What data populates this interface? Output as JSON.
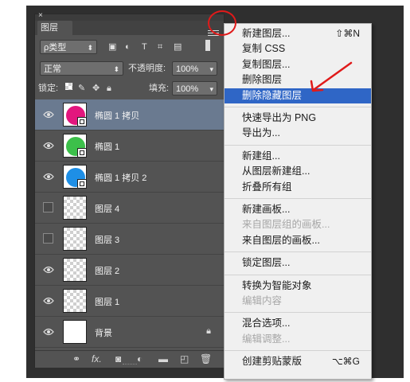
{
  "panel": {
    "tab": "图层",
    "filter_kind": "ρ类型",
    "blend_mode": "正常",
    "opacity_label": "不透明度:",
    "opacity_value": "100%",
    "lock_label": "锁定:",
    "fill_label": "填充:",
    "fill_value": "100%",
    "layers": [
      {
        "name": "椭圆 1 拷贝",
        "visible": true,
        "selected": true,
        "thumb": "circle",
        "color": "#e3167e"
      },
      {
        "name": "椭圆 1",
        "visible": true,
        "selected": false,
        "thumb": "circle",
        "color": "#3cc04a"
      },
      {
        "name": "椭圆 1 拷贝 2",
        "visible": true,
        "selected": false,
        "thumb": "circle",
        "color": "#1e8fe6"
      },
      {
        "name": "图层 4",
        "visible": false,
        "selected": false,
        "thumb": "transparent"
      },
      {
        "name": "图层 3",
        "visible": false,
        "selected": false,
        "thumb": "transparent"
      },
      {
        "name": "图层 2",
        "visible": true,
        "selected": false,
        "thumb": "transparent"
      },
      {
        "name": "图层 1",
        "visible": true,
        "selected": false,
        "thumb": "transparent"
      },
      {
        "name": "背景",
        "visible": true,
        "selected": false,
        "thumb": "white",
        "locked": true
      }
    ],
    "footer_fx": "fx."
  },
  "menu": {
    "items": [
      {
        "label": "新建图层...",
        "shortcut": "⇧⌘N"
      },
      {
        "label": "复制 CSS"
      },
      {
        "label": "复制图层..."
      },
      {
        "label": "删除图层"
      },
      {
        "label": "删除隐藏图层",
        "highlighted": true
      },
      {
        "separator": true
      },
      {
        "label": "快速导出为 PNG"
      },
      {
        "label": "导出为..."
      },
      {
        "separator": true
      },
      {
        "label": "新建组..."
      },
      {
        "label": "从图层新建组..."
      },
      {
        "label": "折叠所有组"
      },
      {
        "separator": true
      },
      {
        "label": "新建画板..."
      },
      {
        "label": "来自图层组的画板...",
        "disabled": true
      },
      {
        "label": "来自图层的画板..."
      },
      {
        "separator": true
      },
      {
        "label": "锁定图层..."
      },
      {
        "separator": true
      },
      {
        "label": "转换为智能对象"
      },
      {
        "label": "编辑内容",
        "disabled": true
      },
      {
        "separator": true
      },
      {
        "label": "混合选项..."
      },
      {
        "label": "编辑调整...",
        "disabled": true
      },
      {
        "separator": true
      },
      {
        "label": "创建剪贴蒙版",
        "shortcut": "⌥⌘G"
      }
    ]
  },
  "colors": {
    "highlight": "#2f66c6",
    "annotation": "#e01a1a",
    "selected_layer": "#6a7a90"
  }
}
